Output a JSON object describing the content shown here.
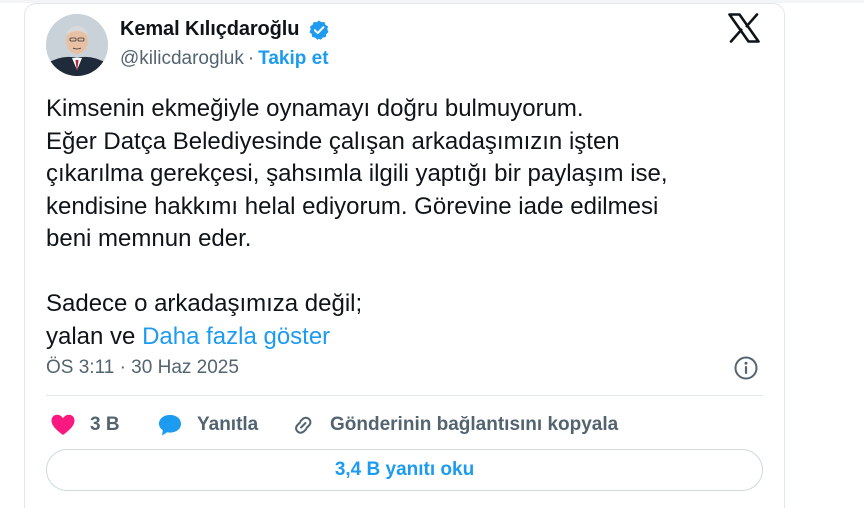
{
  "author": {
    "display_name": "Kemal Kılıçdaroğlu",
    "handle": "@kilicdarogluk",
    "separator": "·",
    "follow_label": "Takip et",
    "verified": true
  },
  "tweet": {
    "lines_block1": [
      "Kimsenin ekmeğiyle oynamayı doğru bulmuyorum.",
      "Eğer Datça Belediyesinde çalışan arkadaşımızın işten",
      "çıkarılma gerekçesi, şahsımla ilgili yaptığı bir paylaşım ise,",
      "kendisine hakkımı helal ediyorum. Görevine iade edilmesi",
      "beni memnun eder."
    ],
    "line_block2": "Sadece o arkadaşımıza değil;",
    "last_line_prefix": "yalan ve",
    "show_more_label": "Daha fazla göster",
    "timestamp": "ÖS 3:11 · 30 Haz 2025"
  },
  "actions": {
    "likes": "3 B",
    "reply_label": "Yanıtla",
    "copy_link_label": "Gönderinin bağlantısını kopyala"
  },
  "read_replies_label": "3,4 B yanıtı oku",
  "colors": {
    "accent": "#1d9bf0",
    "like": "#f91880",
    "text": "#0f1419",
    "muted": "#536471"
  }
}
